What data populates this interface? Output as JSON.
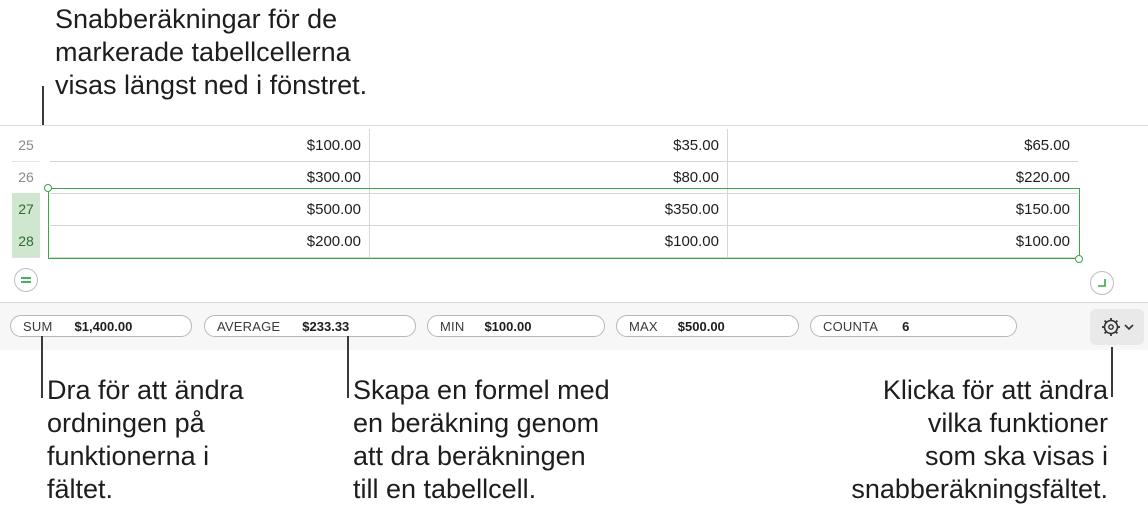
{
  "callouts": {
    "top": [
      "Snabberäkningar för de",
      "markerade tabellcellerna",
      "visas längst ned i fönstret."
    ],
    "bottom_left": [
      "Dra för att ändra",
      "ordningen på",
      "funktionerna i",
      "fältet."
    ],
    "bottom_mid": [
      "Skapa en formel med",
      "en beräkning genom",
      "att dra beräkningen",
      "till en tabellcell."
    ],
    "bottom_right": [
      "Klicka för att ändra",
      "vilka funktioner",
      "som ska visas i",
      "snabberäkningsfältet."
    ]
  },
  "table": {
    "rows": [
      {
        "num": "25",
        "selected": false,
        "cells": [
          "$100.00",
          "$35.00",
          "$65.00"
        ]
      },
      {
        "num": "26",
        "selected": false,
        "cells": [
          "$300.00",
          "$80.00",
          "$220.00"
        ]
      },
      {
        "num": "27",
        "selected": true,
        "cells": [
          "$500.00",
          "$350.00",
          "$150.00"
        ]
      },
      {
        "num": "28",
        "selected": true,
        "cells": [
          "$200.00",
          "$100.00",
          "$100.00"
        ]
      }
    ]
  },
  "status_bar": {
    "sum": {
      "label": "SUM",
      "value": "$1,400.00"
    },
    "average": {
      "label": "AVERAGE",
      "value": "$233.33"
    },
    "min": {
      "label": "MIN",
      "value": "$100.00"
    },
    "max": {
      "label": "MAX",
      "value": "$500.00"
    },
    "counta": {
      "label": "COUNTA",
      "value": "6"
    },
    "gear_icon": "gear-icon",
    "chevron_icon": "chevron-down-icon"
  },
  "colors": {
    "selection": "#3aa64a",
    "selected_row_header": "#cfe7cf"
  }
}
